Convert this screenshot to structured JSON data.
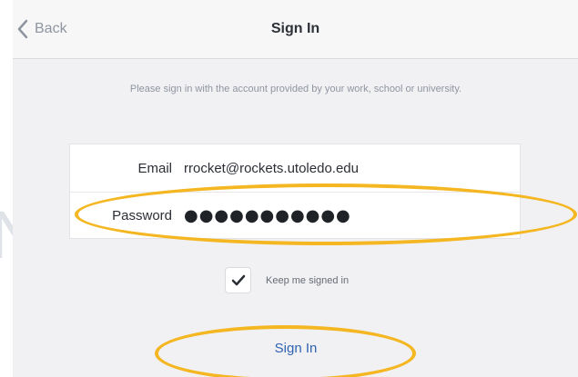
{
  "navbar": {
    "back_label": "Back",
    "title": "Sign In"
  },
  "instructions": {
    "text": "Please sign in with the account provided by your work, school or university."
  },
  "form": {
    "email_label": "Email",
    "email_value": "rrocket@rockets.utoledo.edu",
    "password_label": "Password",
    "password_masked": "●●●●●●●●●●●"
  },
  "keep_signed_in": {
    "label": "Keep me signed in",
    "checked": true
  },
  "actions": {
    "sign_in_label": "Sign In"
  },
  "icons": {
    "back": "chevron-left-icon",
    "checkbox": "check-icon"
  },
  "colors": {
    "accent": "#2f62b0",
    "highlight": "#f4b621",
    "muted_text": "#8f95a0",
    "background": "#f1f1f4"
  }
}
